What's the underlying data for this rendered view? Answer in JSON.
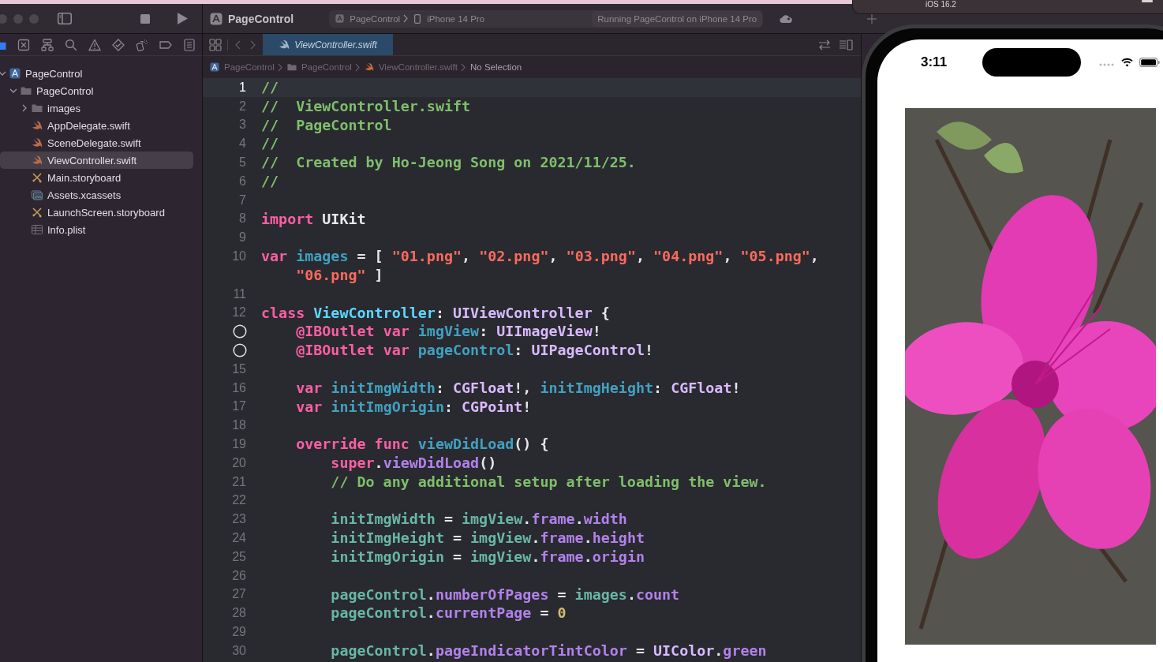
{
  "toolbar": {
    "project_title": "PageControl",
    "scheme": {
      "project": "PageControl",
      "device": "iPhone 14 Pro"
    },
    "status": "Running PageControl on iPhone 14 Pro"
  },
  "navigator_tabs": [
    {
      "kind": "project",
      "selected": true
    },
    {
      "kind": "source-control",
      "selected": false
    },
    {
      "kind": "symbols",
      "selected": false
    },
    {
      "kind": "find",
      "selected": false
    },
    {
      "kind": "issues",
      "selected": false
    },
    {
      "kind": "tests",
      "selected": false
    },
    {
      "kind": "debug",
      "selected": false
    },
    {
      "kind": "breakpoints",
      "selected": false
    },
    {
      "kind": "reports",
      "selected": false
    }
  ],
  "file_tree": [
    {
      "label": "PageControl",
      "kind": "project",
      "expanded": true,
      "selected": false,
      "children": [
        {
          "label": "PageControl",
          "kind": "folder",
          "expanded": true,
          "selected": false,
          "children": [
            {
              "label": "images",
              "kind": "folder",
              "expanded": false,
              "selected": false
            },
            {
              "label": "AppDelegate.swift",
              "kind": "swift",
              "selected": false
            },
            {
              "label": "SceneDelegate.swift",
              "kind": "swift",
              "selected": false
            },
            {
              "label": "ViewController.swift",
              "kind": "swift",
              "selected": true
            },
            {
              "label": "Main.storyboard",
              "kind": "storyboard",
              "selected": false
            },
            {
              "label": "Assets.xcassets",
              "kind": "assets",
              "selected": false
            },
            {
              "label": "LaunchScreen.storyboard",
              "kind": "storyboard",
              "selected": false
            },
            {
              "label": "Info.plist",
              "kind": "plist",
              "selected": false
            }
          ]
        }
      ]
    }
  ],
  "editor_tabs": [
    {
      "label": "ViewController.swift",
      "kind": "swift",
      "selected": true
    }
  ],
  "breadcrumb": [
    {
      "label": "PageControl",
      "kind": "project"
    },
    {
      "label": "PageControl",
      "kind": "folder"
    },
    {
      "label": "ViewController.swift",
      "kind": "swift"
    },
    {
      "label": "No Selection",
      "kind": "text"
    }
  ],
  "code_lines": [
    {
      "number": "1",
      "current": true,
      "tokens": [
        {
          "kind": "comment",
          "text": "//"
        }
      ]
    },
    {
      "number": "2",
      "current": false,
      "tokens": [
        {
          "kind": "comment",
          "text": "//  ViewController.swift"
        }
      ]
    },
    {
      "number": "3",
      "current": false,
      "tokens": [
        {
          "kind": "comment",
          "text": "//  PageControl"
        }
      ]
    },
    {
      "number": "4",
      "current": false,
      "tokens": [
        {
          "kind": "comment",
          "text": "//"
        }
      ]
    },
    {
      "number": "5",
      "current": false,
      "tokens": [
        {
          "kind": "comment",
          "text": "//  Created by Ho-Jeong Song on 2021/11/25."
        }
      ]
    },
    {
      "number": "6",
      "current": false,
      "tokens": [
        {
          "kind": "comment",
          "text": "//"
        }
      ]
    },
    {
      "number": "7",
      "current": false
    },
    {
      "number": "8",
      "current": false,
      "tokens": [
        {
          "kind": "keyword",
          "text": "import "
        },
        {
          "kind": "plain",
          "text": "UIKit"
        }
      ]
    },
    {
      "number": "9",
      "current": false
    },
    {
      "number": "10",
      "current": false,
      "tokens": [
        {
          "kind": "keyword",
          "text": "var "
        },
        {
          "kind": "decl",
          "text": "images"
        },
        {
          "kind": "plain",
          "text": " = [ "
        },
        {
          "kind": "string",
          "text": "\"01.png\""
        },
        {
          "kind": "plain",
          "text": ", "
        },
        {
          "kind": "string",
          "text": "\"02.png\""
        },
        {
          "kind": "plain",
          "text": ", "
        },
        {
          "kind": "string",
          "text": "\"03.png\""
        },
        {
          "kind": "plain",
          "text": ", "
        },
        {
          "kind": "string",
          "text": "\"04.png\""
        },
        {
          "kind": "plain",
          "text": ", "
        },
        {
          "kind": "string",
          "text": "\"05.png\""
        },
        {
          "kind": "plain",
          "text": ","
        }
      ],
      "continuation": [
        {
          "kind": "string",
          "text": "    \"06.png\""
        },
        {
          "kind": "plain",
          "text": " ]"
        }
      ]
    },
    {
      "number": "11",
      "current": false
    },
    {
      "number": "12",
      "current": false,
      "tokens": [
        {
          "kind": "keyword",
          "text": "class "
        },
        {
          "kind": "type-decl",
          "text": "ViewController"
        },
        {
          "kind": "plain",
          "text": ": "
        },
        {
          "kind": "type",
          "text": "UIViewController"
        },
        {
          "kind": "plain",
          "text": " {"
        }
      ]
    },
    {
      "outlet_connected": false,
      "current": false,
      "tokens": [
        {
          "kind": "keyword",
          "text": "    @IBOutlet var "
        },
        {
          "kind": "decl",
          "text": "imgView"
        },
        {
          "kind": "plain",
          "text": ": "
        },
        {
          "kind": "type",
          "text": "UIImageView"
        },
        {
          "kind": "plain",
          "text": "!"
        }
      ]
    },
    {
      "outlet_connected": false,
      "current": false,
      "tokens": [
        {
          "kind": "keyword",
          "text": "    @IBOutlet var "
        },
        {
          "kind": "decl",
          "text": "pageControl"
        },
        {
          "kind": "plain",
          "text": ": "
        },
        {
          "kind": "type",
          "text": "UIPageControl"
        },
        {
          "kind": "plain",
          "text": "!"
        }
      ]
    },
    {
      "number": "15",
      "current": false
    },
    {
      "number": "16",
      "current": false,
      "tokens": [
        {
          "kind": "keyword",
          "text": "    var "
        },
        {
          "kind": "decl",
          "text": "initImgWidth"
        },
        {
          "kind": "plain",
          "text": ": "
        },
        {
          "kind": "type",
          "text": "CGFloat"
        },
        {
          "kind": "plain",
          "text": "!, "
        },
        {
          "kind": "decl",
          "text": "initImgHeight"
        },
        {
          "kind": "plain",
          "text": ": "
        },
        {
          "kind": "type",
          "text": "CGFloat"
        },
        {
          "kind": "plain",
          "text": "!"
        }
      ]
    },
    {
      "number": "17",
      "current": false,
      "tokens": [
        {
          "kind": "keyword",
          "text": "    var "
        },
        {
          "kind": "decl",
          "text": "initImgOrigin"
        },
        {
          "kind": "plain",
          "text": ": "
        },
        {
          "kind": "type",
          "text": "CGPoint"
        },
        {
          "kind": "plain",
          "text": "!"
        }
      ]
    },
    {
      "number": "18",
      "current": false
    },
    {
      "number": "19",
      "current": false,
      "tokens": [
        {
          "kind": "keyword",
          "text": "    override func "
        },
        {
          "kind": "decl",
          "text": "viewDidLoad"
        },
        {
          "kind": "plain",
          "text": "() {"
        }
      ]
    },
    {
      "number": "20",
      "current": false,
      "tokens": [
        {
          "kind": "keyword",
          "text": "        super"
        },
        {
          "kind": "plain",
          "text": "."
        },
        {
          "kind": "member",
          "text": "viewDidLoad"
        },
        {
          "kind": "plain",
          "text": "()"
        }
      ]
    },
    {
      "number": "21",
      "current": false,
      "tokens": [
        {
          "kind": "comment",
          "text": "        // Do any additional setup after loading the view."
        }
      ]
    },
    {
      "number": "22",
      "current": false
    },
    {
      "number": "23",
      "current": false,
      "tokens": [
        {
          "kind": "ref",
          "text": "        initImgWidth"
        },
        {
          "kind": "plain",
          "text": " = "
        },
        {
          "kind": "ref",
          "text": "imgView"
        },
        {
          "kind": "plain",
          "text": "."
        },
        {
          "kind": "member",
          "text": "frame"
        },
        {
          "kind": "plain",
          "text": "."
        },
        {
          "kind": "member",
          "text": "width"
        }
      ]
    },
    {
      "number": "24",
      "current": false,
      "tokens": [
        {
          "kind": "ref",
          "text": "        initImgHeight"
        },
        {
          "kind": "plain",
          "text": " = "
        },
        {
          "kind": "ref",
          "text": "imgView"
        },
        {
          "kind": "plain",
          "text": "."
        },
        {
          "kind": "member",
          "text": "frame"
        },
        {
          "kind": "plain",
          "text": "."
        },
        {
          "kind": "member",
          "text": "height"
        }
      ]
    },
    {
      "number": "25",
      "current": false,
      "tokens": [
        {
          "kind": "ref",
          "text": "        initImgOrigin"
        },
        {
          "kind": "plain",
          "text": " = "
        },
        {
          "kind": "ref",
          "text": "imgView"
        },
        {
          "kind": "plain",
          "text": "."
        },
        {
          "kind": "member",
          "text": "frame"
        },
        {
          "kind": "plain",
          "text": "."
        },
        {
          "kind": "member",
          "text": "origin"
        }
      ]
    },
    {
      "number": "26",
      "current": false
    },
    {
      "number": "27",
      "current": false,
      "tokens": [
        {
          "kind": "ref",
          "text": "        pageControl"
        },
        {
          "kind": "plain",
          "text": "."
        },
        {
          "kind": "member",
          "text": "numberOfPages"
        },
        {
          "kind": "plain",
          "text": " = "
        },
        {
          "kind": "ref",
          "text": "images"
        },
        {
          "kind": "plain",
          "text": "."
        },
        {
          "kind": "member",
          "text": "count"
        }
      ]
    },
    {
      "number": "28",
      "current": false,
      "tokens": [
        {
          "kind": "ref",
          "text": "        pageControl"
        },
        {
          "kind": "plain",
          "text": "."
        },
        {
          "kind": "member",
          "text": "currentPage"
        },
        {
          "kind": "plain",
          "text": " = "
        },
        {
          "kind": "number",
          "text": "0"
        }
      ]
    },
    {
      "number": "29",
      "current": false
    },
    {
      "number": "30",
      "current": false,
      "tokens": [
        {
          "kind": "ref",
          "text": "        pageControl"
        },
        {
          "kind": "plain",
          "text": "."
        },
        {
          "kind": "member",
          "text": "pageIndicatorTintColor"
        },
        {
          "kind": "plain",
          "text": " = "
        },
        {
          "kind": "type",
          "text": "UIColor"
        },
        {
          "kind": "plain",
          "text": "."
        },
        {
          "kind": "member",
          "text": "green"
        }
      ]
    }
  ],
  "simulator": {
    "subtitle": "iOS 16.2",
    "status_bar": {
      "time": "3:11"
    }
  }
}
